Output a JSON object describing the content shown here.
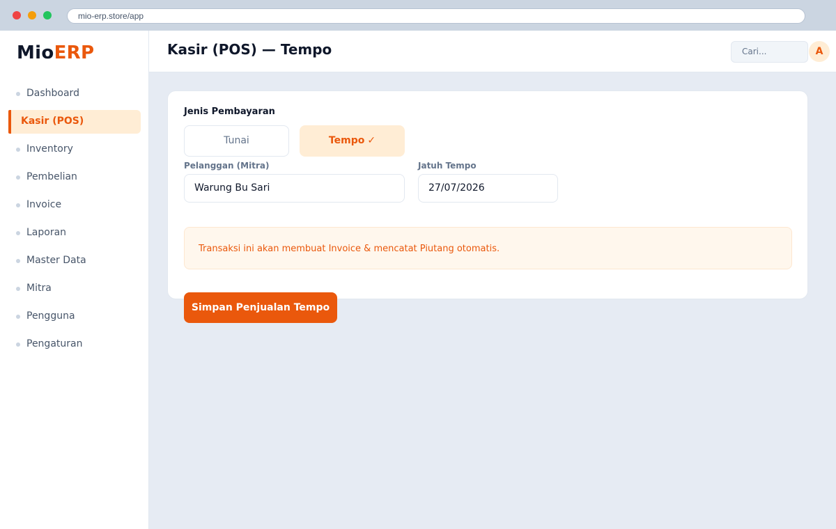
{
  "browser": {
    "url": "mio-erp.store/app"
  },
  "brand": {
    "name_primary": "Mio",
    "name_accent": "ERP",
    "accent_color": "#ea580c"
  },
  "sidebar": {
    "items": [
      {
        "label": "Dashboard",
        "active": false
      },
      {
        "label": "Kasir (POS)",
        "active": true
      },
      {
        "label": "Inventory",
        "active": false
      },
      {
        "label": "Pembelian",
        "active": false
      },
      {
        "label": "Invoice",
        "active": false
      },
      {
        "label": "Laporan",
        "active": false
      },
      {
        "label": "Master Data",
        "active": false
      },
      {
        "label": "Mitra",
        "active": false
      },
      {
        "label": "Pengguna",
        "active": false
      },
      {
        "label": "Pengaturan",
        "active": false
      }
    ]
  },
  "header": {
    "title": "Kasir (POS) — Tempo",
    "search_placeholder": "Cari...",
    "avatar_initial": "A"
  },
  "payment": {
    "section_label": "Jenis Pembayaran",
    "options": [
      {
        "label": "Tunai",
        "selected": false
      },
      {
        "label": "Tempo",
        "selected": true,
        "check_icon": "✓"
      }
    ]
  },
  "form": {
    "customer_label": "Pelanggan (Mitra)",
    "customer_value": "Warung Bu Sari",
    "due_label": "Jatuh Tempo",
    "due_value": "27/07/2026"
  },
  "notice": {
    "text": "Transaksi ini akan membuat Invoice & mencatat Piutang otomatis."
  },
  "actions": {
    "save_label": "Simpan Penjualan Tempo"
  }
}
